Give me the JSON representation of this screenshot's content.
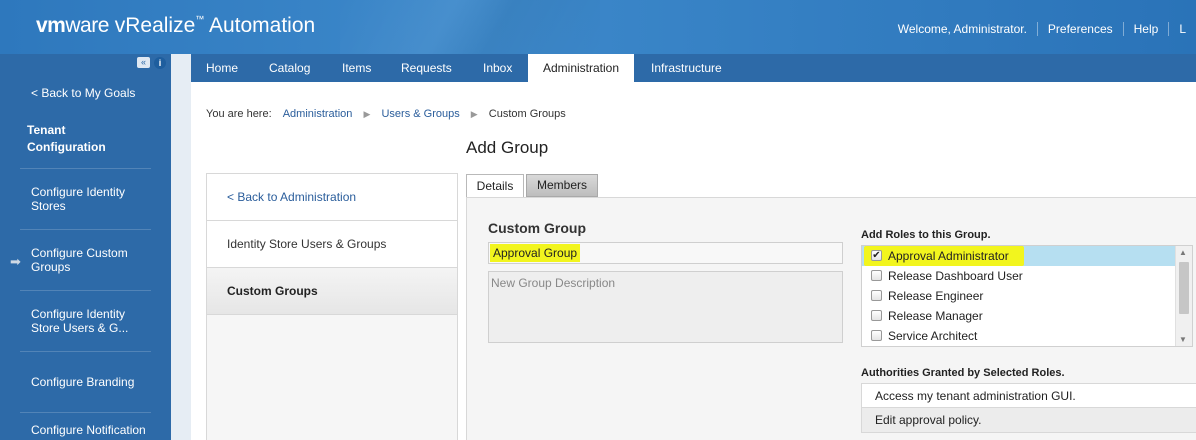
{
  "header": {
    "brand_vm": "vm",
    "brand_ware": "ware",
    "brand_product": "vRealize",
    "brand_tm": "™",
    "brand_suffix": "Automation",
    "welcome": "Welcome, Administrator.",
    "preferences": "Preferences",
    "help": "Help",
    "logout_partial": "L"
  },
  "sidebar": {
    "collapse_glyph": "«",
    "info_glyph": "i",
    "back_label": "< Back to My Goals",
    "section_title": "Tenant Configuration",
    "current_arrow": "➡",
    "items": [
      {
        "label": "Configure Identity Stores"
      },
      {
        "label": "Configure Custom Groups"
      },
      {
        "label": "Configure Identity Store Users & G..."
      },
      {
        "label": "Configure Branding"
      },
      {
        "label": "Configure Notification"
      }
    ]
  },
  "nav": {
    "tabs": [
      {
        "label": "Home"
      },
      {
        "label": "Catalog"
      },
      {
        "label": "Items"
      },
      {
        "label": "Requests"
      },
      {
        "label": "Inbox"
      },
      {
        "label": "Administration"
      },
      {
        "label": "Infrastructure"
      }
    ]
  },
  "breadcrumb": {
    "prefix": "You are here:",
    "items": [
      "Administration",
      "Users & Groups",
      "Custom Groups"
    ],
    "sep_glyph": "▶"
  },
  "page": {
    "title": "Add Group"
  },
  "left_panel": {
    "items": [
      {
        "label": "< Back to Administration"
      },
      {
        "label": "Identity Store Users & Groups"
      },
      {
        "label": "Custom Groups"
      }
    ]
  },
  "tabs": {
    "details": "Details",
    "members": "Members"
  },
  "form": {
    "section_label": "Custom Group",
    "name_value": "Approval Group",
    "description_placeholder": "New Group Description",
    "roles_label": "Add Roles to this Group.",
    "roles": [
      {
        "label": "Approval Administrator",
        "checked": true
      },
      {
        "label": "Release Dashboard User",
        "checked": false
      },
      {
        "label": "Release Engineer",
        "checked": false
      },
      {
        "label": "Release Manager",
        "checked": false
      },
      {
        "label": "Service Architect",
        "checked": false
      }
    ],
    "check_glyph": "✔",
    "scroll_up_glyph": "▲",
    "scroll_down_glyph": "▼",
    "authorities_label": "Authorities Granted by Selected Roles.",
    "authorities": [
      "Access my tenant administration GUI.",
      "Edit approval policy."
    ]
  },
  "colors": {
    "header_blue": "#3b83c4",
    "sidebar_blue": "#2d6aa8",
    "highlight_yellow": "#f2f51e",
    "selected_row": "#b6dff1",
    "link": "#2a5d9b"
  }
}
